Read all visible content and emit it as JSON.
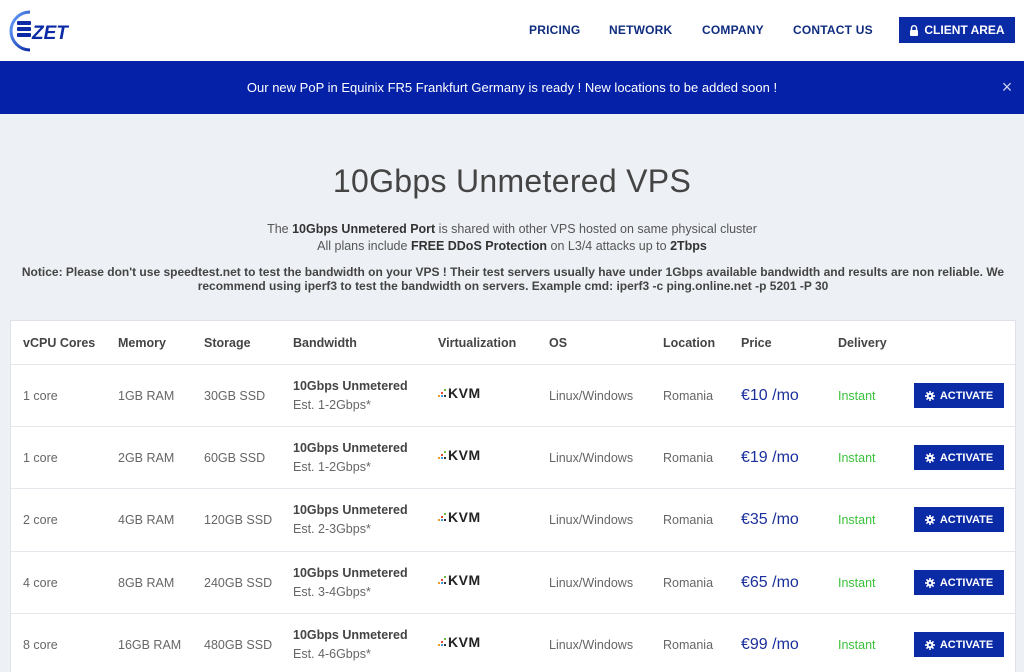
{
  "nav": {
    "logo_text": "ZET",
    "links": [
      "PRICING",
      "NETWORK",
      "COMPANY",
      "CONTACT US"
    ],
    "client_area": "CLIENT AREA"
  },
  "banner": {
    "text": "Our new PoP in Equinix FR5 Frankfurt Germany is ready ! New locations to be added soon !",
    "close": "×"
  },
  "hero": {
    "title": "10Gbps Unmetered VPS",
    "line1_pre": "The ",
    "line1_bold": "10Gbps Unmetered Port",
    "line1_post": " is shared with other VPS hosted on same physical cluster",
    "line2_pre": "All plans include ",
    "line2_bold": "FREE DDoS Protection",
    "line2_mid": " on L3/4 attacks up to ",
    "line2_bold2": "2Tbps",
    "notice": "Notice: Please don't use speedtest.net to test the bandwidth on your VPS ! Their test servers usually have under 1Gbps available bandwidth and results are non reliable. We recommend using iperf3 to test the bandwidth on servers. Example cmd: iperf3 -c ping.online.net -p 5201 -P 30"
  },
  "table": {
    "headers": [
      "vCPU Cores",
      "Memory",
      "Storage",
      "Bandwidth",
      "Virtualization",
      "OS",
      "Location",
      "Price",
      "Delivery"
    ],
    "activate_label": "ACTIVATE",
    "rows": [
      {
        "cores": "1 core",
        "memory": "1GB RAM",
        "storage": "30GB SSD",
        "bw": "10Gbps Unmetered",
        "est": "Est. 1-2Gbps*",
        "virt": "KVM",
        "os": "Linux/Windows",
        "location": "Romania",
        "price": "€10 /mo",
        "delivery": "Instant"
      },
      {
        "cores": "1 core",
        "memory": "2GB RAM",
        "storage": "60GB SSD",
        "bw": "10Gbps Unmetered",
        "est": "Est. 1-2Gbps*",
        "virt": "KVM",
        "os": "Linux/Windows",
        "location": "Romania",
        "price": "€19 /mo",
        "delivery": "Instant"
      },
      {
        "cores": "2 core",
        "memory": "4GB RAM",
        "storage": "120GB SSD",
        "bw": "10Gbps Unmetered",
        "est": "Est. 2-3Gbps*",
        "virt": "KVM",
        "os": "Linux/Windows",
        "location": "Romania",
        "price": "€35 /mo",
        "delivery": "Instant"
      },
      {
        "cores": "4 core",
        "memory": "8GB RAM",
        "storage": "240GB SSD",
        "bw": "10Gbps Unmetered",
        "est": "Est. 3-4Gbps*",
        "virt": "KVM",
        "os": "Linux/Windows",
        "location": "Romania",
        "price": "€65 /mo",
        "delivery": "Instant"
      },
      {
        "cores": "8 core",
        "memory": "16GB RAM",
        "storage": "480GB SSD",
        "bw": "10Gbps Unmetered",
        "est": "Est. 4-6Gbps*",
        "virt": "KVM",
        "os": "Linux/Windows",
        "location": "Romania",
        "price": "€99 /mo",
        "delivery": "Instant"
      }
    ]
  },
  "colors": {
    "brand_blue": "#0b2aa6",
    "banner_blue": "#0521a8",
    "price_blue": "#1a2f9c",
    "instant_green": "#3cc23c"
  }
}
